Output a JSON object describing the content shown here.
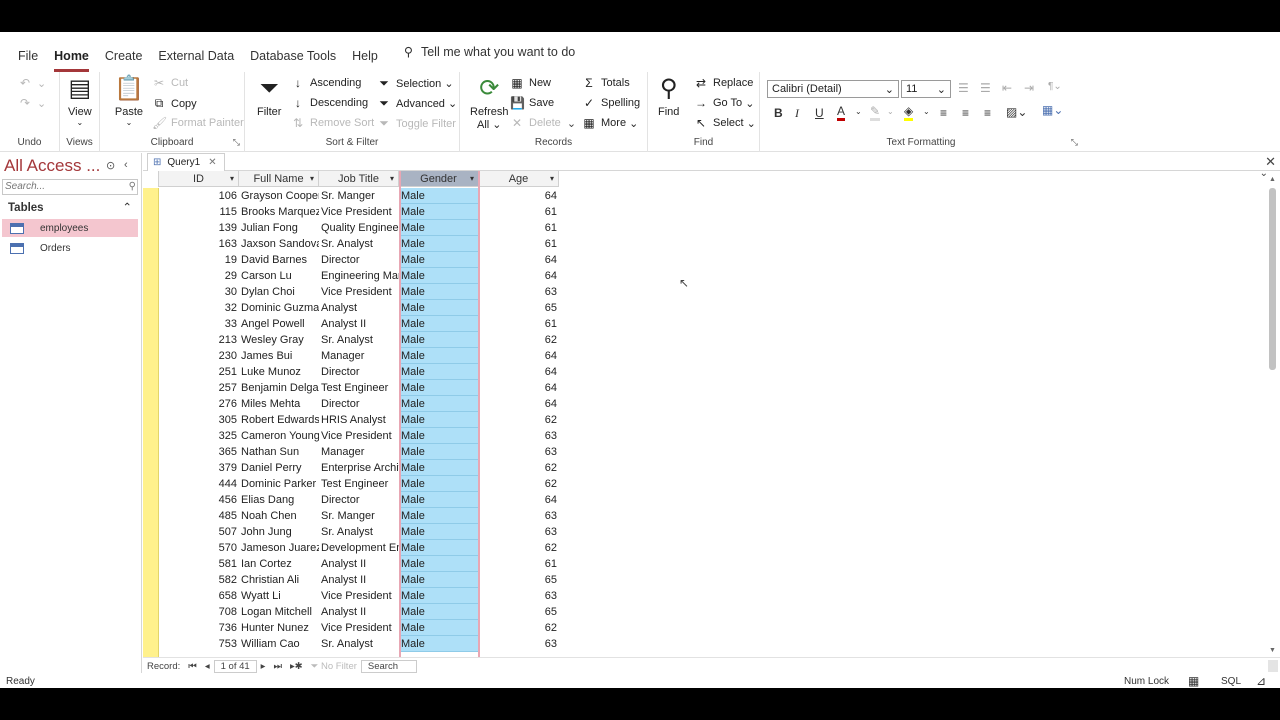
{
  "tabs": [
    "File",
    "Home",
    "Create",
    "External Data",
    "Database Tools",
    "Help"
  ],
  "tell_me": "Tell me what you want to do",
  "groups": {
    "undo": "Undo",
    "views": "Views",
    "clipboard": "Clipboard",
    "sort_filter": "Sort & Filter",
    "records": "Records",
    "find": "Find",
    "text_formatting": "Text Formatting"
  },
  "buttons": {
    "view": "View",
    "paste": "Paste",
    "cut": "Cut",
    "copy": "Copy",
    "format_painter": "Format Painter",
    "filter": "Filter",
    "ascending": "Ascending",
    "descending": "Descending",
    "remove_sort": "Remove Sort",
    "selection": "Selection",
    "advanced": "Advanced",
    "toggle_filter": "Toggle Filter",
    "refresh": "Refresh",
    "refresh_all": "All",
    "new": "New",
    "save": "Save",
    "delete": "Delete",
    "totals": "Totals",
    "spelling": "Spelling",
    "more": "More",
    "find": "Find",
    "replace": "Replace",
    "goto": "Go To",
    "select": "Select"
  },
  "font": {
    "name": "Calibri (Detail)",
    "size": "11"
  },
  "nav": {
    "title": "All Access ...",
    "search_placeholder": "Search...",
    "section": "Tables",
    "items": [
      "employees",
      "Orders"
    ]
  },
  "doc_tab": "Query1",
  "columns": [
    "ID",
    "Full Name",
    "Job Title",
    "Gender",
    "Age"
  ],
  "rows": [
    [
      "106",
      "Grayson Cooper",
      "Sr. Manger",
      "Male",
      "64"
    ],
    [
      "115",
      "Brooks Marquez",
      "Vice President",
      "Male",
      "61"
    ],
    [
      "139",
      "Julian Fong",
      "Quality Engineer",
      "Male",
      "61"
    ],
    [
      "163",
      "Jaxson Sandoval",
      "Sr. Analyst",
      "Male",
      "61"
    ],
    [
      "19",
      "David Barnes",
      "Director",
      "Male",
      "64"
    ],
    [
      "29",
      "Carson Lu",
      "Engineering Manager",
      "Male",
      "64"
    ],
    [
      "30",
      "Dylan Choi",
      "Vice President",
      "Male",
      "63"
    ],
    [
      "32",
      "Dominic Guzman",
      "Analyst",
      "Male",
      "65"
    ],
    [
      "33",
      "Angel Powell",
      "Analyst II",
      "Male",
      "61"
    ],
    [
      "213",
      "Wesley Gray",
      "Sr. Analyst",
      "Male",
      "62"
    ],
    [
      "230",
      "James Bui",
      "Manager",
      "Male",
      "64"
    ],
    [
      "251",
      "Luke Munoz",
      "Director",
      "Male",
      "64"
    ],
    [
      "257",
      "Benjamin Delgado",
      "Test Engineer",
      "Male",
      "64"
    ],
    [
      "276",
      "Miles Mehta",
      "Director",
      "Male",
      "64"
    ],
    [
      "305",
      "Robert Edwards",
      "HRIS Analyst",
      "Male",
      "62"
    ],
    [
      "325",
      "Cameron Young",
      "Vice President",
      "Male",
      "63"
    ],
    [
      "365",
      "Nathan Sun",
      "Manager",
      "Male",
      "63"
    ],
    [
      "379",
      "Daniel Perry",
      "Enterprise Architect",
      "Male",
      "62"
    ],
    [
      "444",
      "Dominic Parker",
      "Test Engineer",
      "Male",
      "62"
    ],
    [
      "456",
      "Elias Dang",
      "Director",
      "Male",
      "64"
    ],
    [
      "485",
      "Noah Chen",
      "Sr. Manger",
      "Male",
      "63"
    ],
    [
      "507",
      "John Jung",
      "Sr. Analyst",
      "Male",
      "63"
    ],
    [
      "570",
      "Jameson Juarez",
      "Development Engineer",
      "Male",
      "62"
    ],
    [
      "581",
      "Ian Cortez",
      "Analyst II",
      "Male",
      "61"
    ],
    [
      "582",
      "Christian Ali",
      "Analyst II",
      "Male",
      "65"
    ],
    [
      "658",
      "Wyatt Li",
      "Vice President",
      "Male",
      "63"
    ],
    [
      "708",
      "Logan Mitchell",
      "Analyst II",
      "Male",
      "65"
    ],
    [
      "736",
      "Hunter Nunez",
      "Vice President",
      "Male",
      "62"
    ],
    [
      "753",
      "William Cao",
      "Sr. Analyst",
      "Male",
      "63"
    ]
  ],
  "record_nav": {
    "label": "Record:",
    "position": "1 of 41",
    "no_filter": "No Filter",
    "search": "Search"
  },
  "status": {
    "left": "Ready",
    "num_lock": "Num Lock",
    "sql": "SQL"
  },
  "colors": {
    "accent": "#a4373a",
    "selector": "#fff18c",
    "gender_fill": "#aee0f8",
    "nav_selected": "#f4c6cf"
  }
}
